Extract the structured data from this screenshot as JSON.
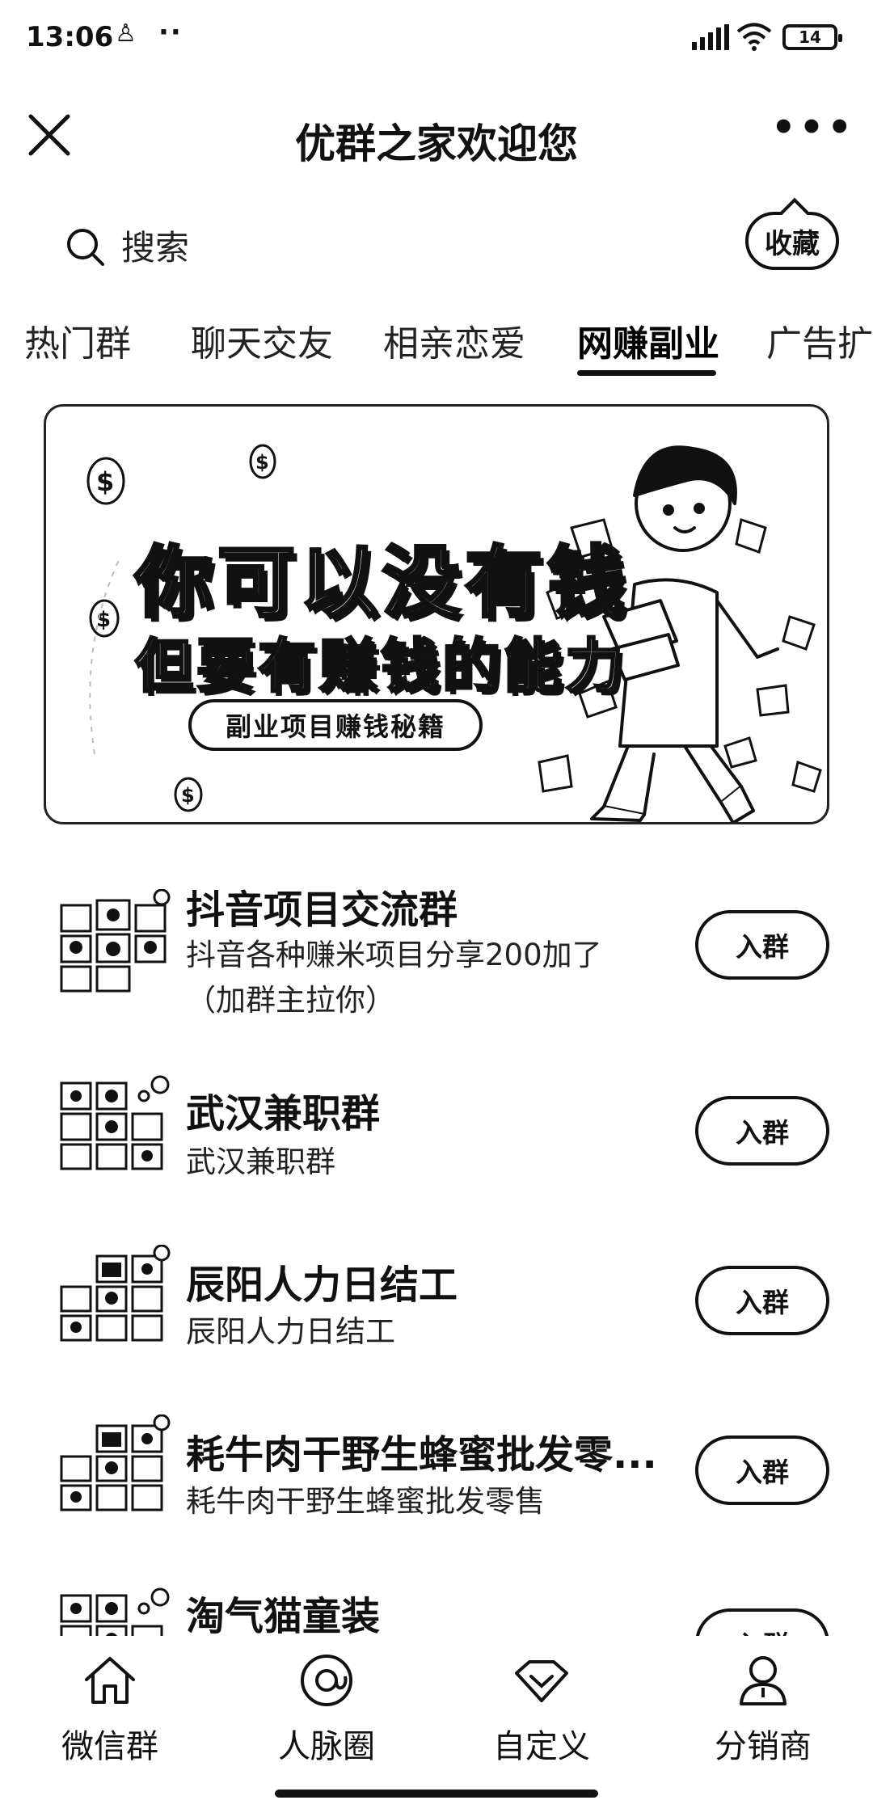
{
  "status": {
    "time": "13:06",
    "battery": "14"
  },
  "header": {
    "title": "优群之家欢迎您"
  },
  "search": {
    "placeholder": "搜索"
  },
  "favorite_label": "收藏",
  "tabs": [
    {
      "label": "热门群"
    },
    {
      "label": "聊天交友"
    },
    {
      "label": "相亲恋爱"
    },
    {
      "label": "网赚副业",
      "active": true
    },
    {
      "label": "广告扩"
    }
  ],
  "banner": {
    "line1": "你可以没有钱",
    "line2": "但要有赚钱的能力",
    "button": "副业项目赚钱秘籍"
  },
  "groups": [
    {
      "name": "抖音项目交流群",
      "desc": "抖音各种赚米项目分享200加了（加群主拉你）",
      "button": "入群"
    },
    {
      "name": "武汉兼职群",
      "desc": "武汉兼职群",
      "button": "入群"
    },
    {
      "name": "辰阳人力日结工",
      "desc": "辰阳人力日结工",
      "button": "入群"
    },
    {
      "name": "耗牛肉干野生蜂蜜批发零...",
      "desc": "耗牛肉干野生蜂蜜批发零售",
      "button": "入群"
    },
    {
      "name": "淘气猫童装",
      "desc": "",
      "button": "入群"
    }
  ],
  "bottom_nav": [
    {
      "label": "微信群",
      "icon": "house-icon"
    },
    {
      "label": "人脉圈",
      "icon": "at-circle-icon"
    },
    {
      "label": "自定义",
      "icon": "diamond-icon"
    },
    {
      "label": "分销商",
      "icon": "person-icon"
    }
  ]
}
